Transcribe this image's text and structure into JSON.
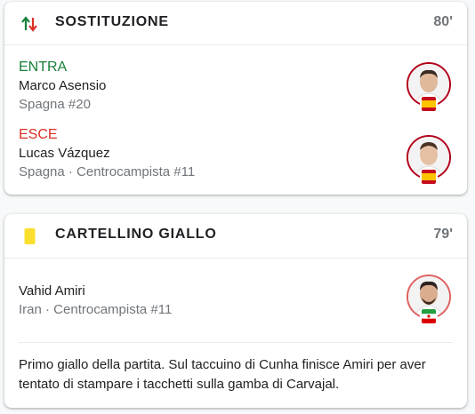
{
  "substitution": {
    "title": "SOSTITUZIONE",
    "minute": "80'",
    "in": {
      "role": "ENTRA",
      "name": "Marco Asensio",
      "meta": "Spagna #20",
      "flag_icon": "spain-flag-icon"
    },
    "out": {
      "role": "ESCE",
      "name": "Lucas Vázquez",
      "meta": "Spagna · Centrocampista #11",
      "flag_icon": "spain-flag-icon"
    }
  },
  "yellow_card": {
    "title": "CARTELLINO GIALLO",
    "minute": "79'",
    "player": {
      "name": "Vahid Amiri",
      "meta": "Iran · Centrocampista #11",
      "flag_icon": "iran-flag-icon"
    },
    "comment": "Primo giallo della partita. Sul taccuino di Cunha finisce Amiri per aver tentato di stampare i tacchetti sulla gamba di Carvajal."
  },
  "colors": {
    "in_green": "#188038",
    "out_red": "#d93025",
    "avatar_ring": "#b3001b",
    "yellow_card": "#fbdf2f",
    "minute_gray": "#70757a"
  }
}
